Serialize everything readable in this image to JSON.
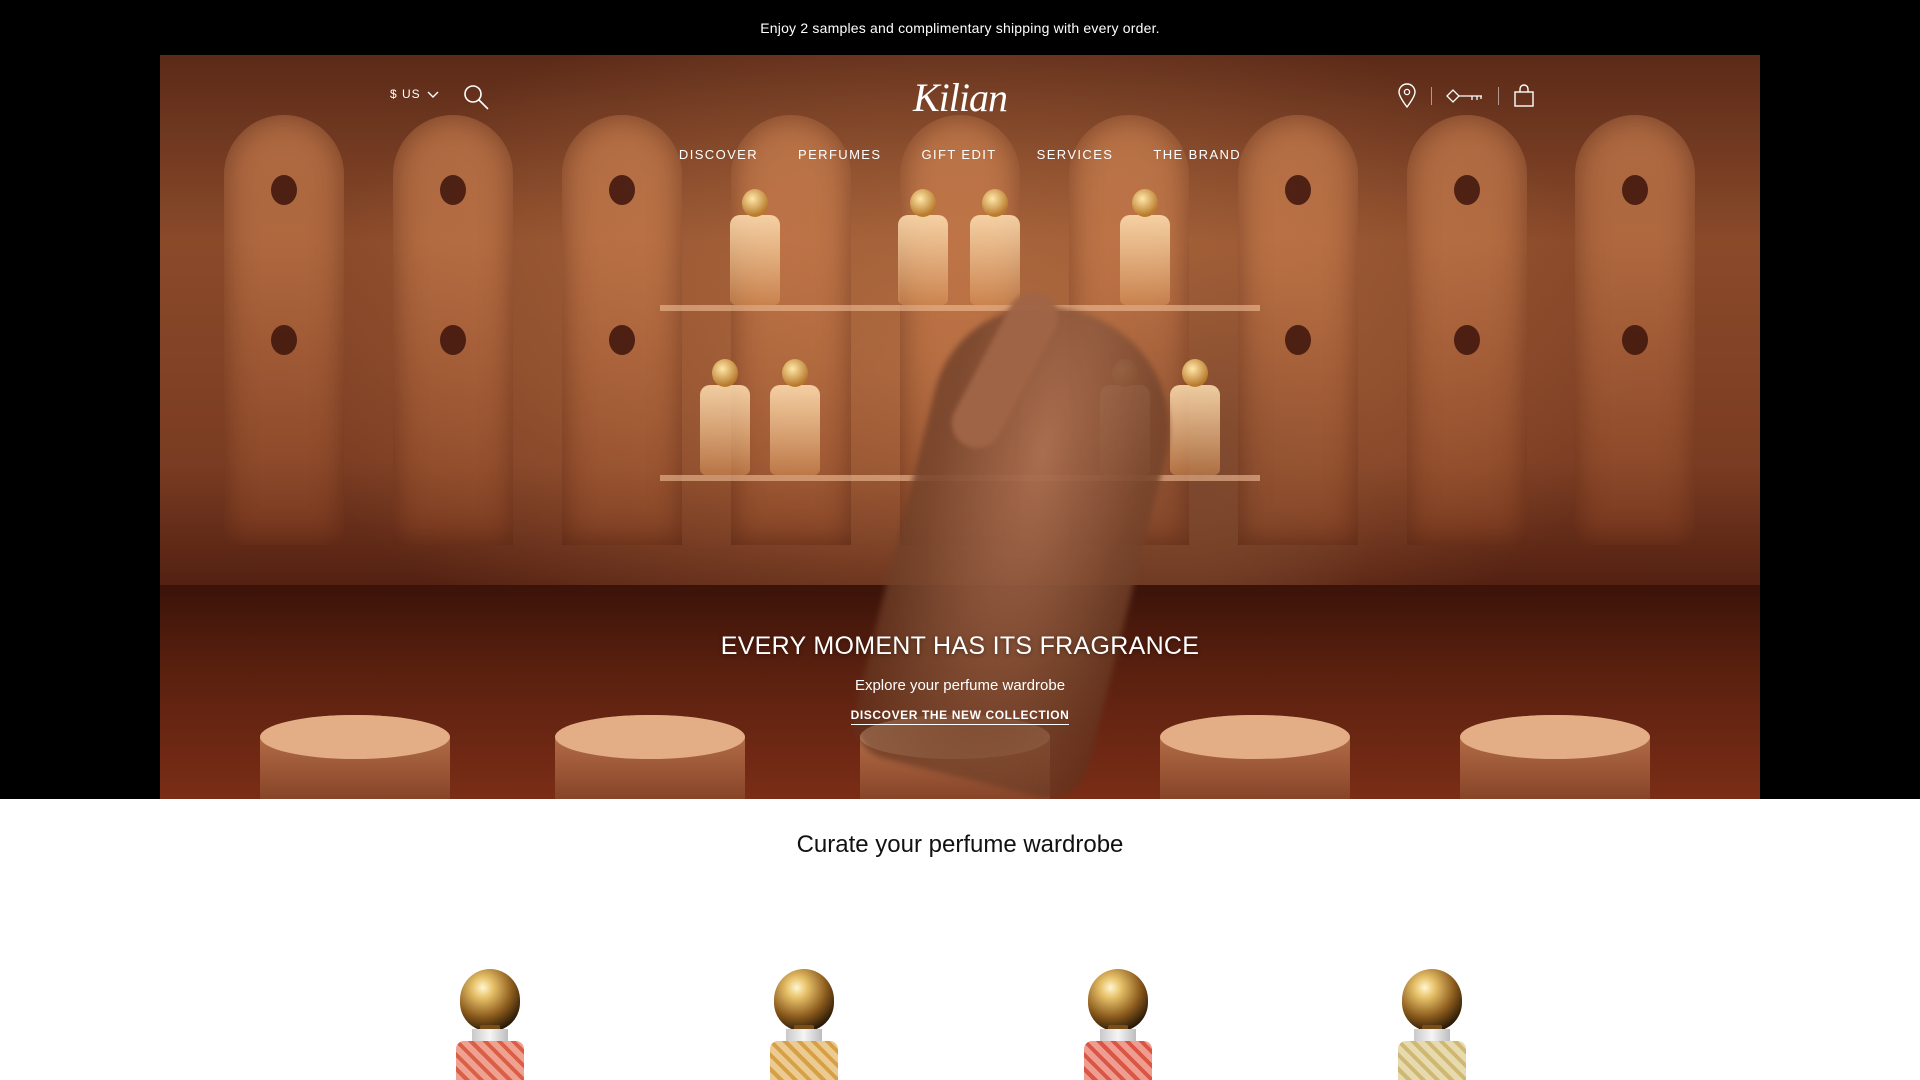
{
  "announcement": "Enjoy 2 samples and complimentary shipping with every order.",
  "header": {
    "currency": "$ US",
    "logo_text": "Kilian",
    "nav": [
      "DISCOVER",
      "PERFUMES",
      "GIFT EDIT",
      "SERVICES",
      "THE BRAND"
    ]
  },
  "hero": {
    "title": "EVERY MOMENT HAS ITS FRAGRANCE",
    "subtitle": "Explore your perfume wardrobe",
    "cta": "DISCOVER THE NEW COLLECTION"
  },
  "section": {
    "title": "Curate your perfume wardrobe"
  },
  "products": [
    {
      "liquid_color": "#e5644a"
    },
    {
      "liquid_color": "#e0a94a"
    },
    {
      "liquid_color": "#e55a48"
    },
    {
      "liquid_color": "#d9c27a"
    }
  ],
  "icons": [
    "search-icon",
    "chevron-down-icon",
    "location-pin-icon",
    "key-icon",
    "shopping-bag-icon"
  ]
}
